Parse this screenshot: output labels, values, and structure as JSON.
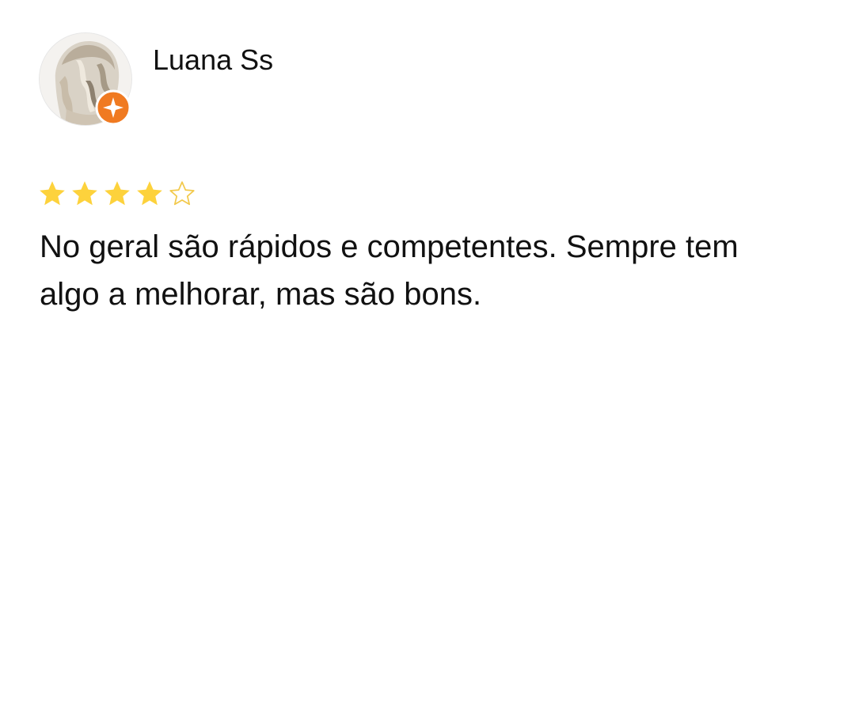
{
  "review": {
    "reviewer_name": "Luana Ss",
    "avatar_icon": "avatar-photo",
    "badge_icon": "local-guide-badge-icon",
    "rating": 4,
    "rating_max": 5,
    "text": "No geral são rápidos e competentes. Sempre tem algo a melhorar, mas são bons.",
    "colors": {
      "star_filled": "#FDD23C",
      "star_outline": "#F2C94C",
      "badge": "#F07A21",
      "text": "#111111",
      "background": "#FFFFFF"
    }
  }
}
